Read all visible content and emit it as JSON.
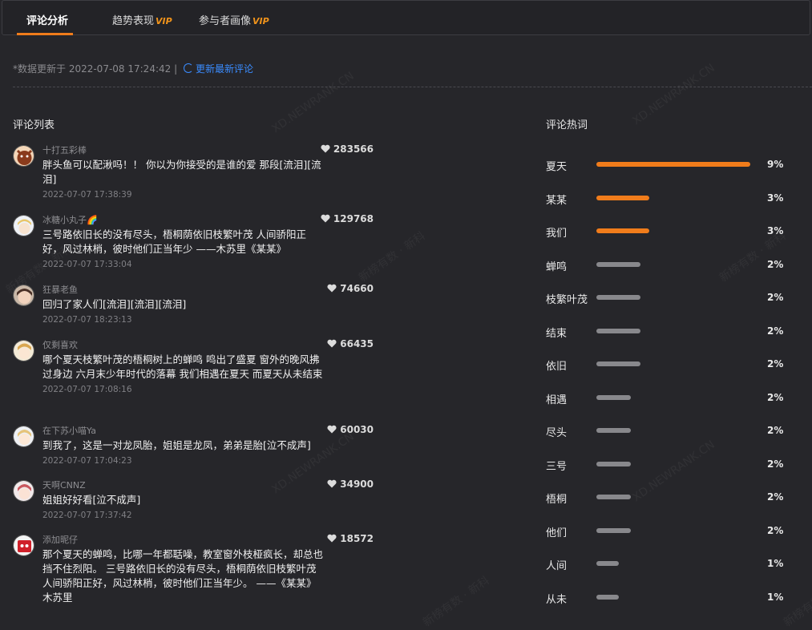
{
  "tabs": [
    {
      "label": "评论分析",
      "vip": ""
    },
    {
      "label": "趋势表现",
      "vip": "VIP"
    },
    {
      "label": "参与者画像",
      "vip": "VIP"
    }
  ],
  "update": {
    "text": "*数据更新于 2022-07-08 17:24:42 |",
    "refresh_label": "更新最新评论"
  },
  "comments_section": {
    "title": "评论列表"
  },
  "comments": [
    {
      "user": "十打五彩棒",
      "text": "胖头鱼可以配湫吗！！ 你以为你接受的是谁的爱 那段[流泪][流泪]",
      "time": "2022-07-07 17:38:39",
      "likes": "283566"
    },
    {
      "user": "冰糖小丸子🌈",
      "text": "三号路依旧长的没有尽头，梧桐荫依旧枝繁叶茂 人间骄阳正好，风过林梢，彼时他们正当年少 ——木苏里《某某》",
      "time": "2022-07-07 17:33:04",
      "likes": "129768"
    },
    {
      "user": "狂暴老鱼",
      "text": "回归了家人们[流泪][流泪][流泪]",
      "time": "2022-07-07 18:23:13",
      "likes": "74660"
    },
    {
      "user": "仅剩喜欢",
      "text": "哪个夏天枝繁叶茂的梧桐树上的蝉鸣 鸣出了盛夏 窗外的晚风拂过身边 六月末少年时代的落幕 我们相遇在夏天 而夏天从未结束",
      "time": "2022-07-07 17:08:16",
      "likes": "66435"
    },
    {
      "user": "在下苏小喵Ya",
      "text": "到我了，这是一对龙凤胎，姐姐是龙凤，弟弟是胎[泣不成声]",
      "time": "2022-07-07 17:04:23",
      "likes": "60030"
    },
    {
      "user": "天啊CNNZ",
      "text": "姐姐好好看[泣不成声]",
      "time": "2022-07-07 17:37:42",
      "likes": "34900"
    },
    {
      "user": "添加昵仔",
      "text": "那个夏天的蝉鸣，比哪一年都聒噪，教室窗外枝桠疯长，却总也挡不住烈阳。 三号路依旧长的没有尽头，梧桐荫依旧枝繁叶茂人间骄阳正好，风过林梢，彼时他们正当年少。 ——《某某》木苏里",
      "time": "",
      "likes": "18572"
    }
  ],
  "hot_section": {
    "title": "评论热词"
  },
  "hot_words": [
    {
      "word": "夏天",
      "pct": "9%",
      "level": 0.9,
      "highlight": true
    },
    {
      "word": "某某",
      "pct": "3%",
      "level": 0.31,
      "highlight": true
    },
    {
      "word": "我们",
      "pct": "3%",
      "level": 0.31,
      "highlight": true
    },
    {
      "word": "蝉鸣",
      "pct": "2%",
      "level": 0.26,
      "highlight": false
    },
    {
      "word": "枝繁叶茂",
      "pct": "2%",
      "level": 0.26,
      "highlight": false
    },
    {
      "word": "结束",
      "pct": "2%",
      "level": 0.26,
      "highlight": false
    },
    {
      "word": "依旧",
      "pct": "2%",
      "level": 0.26,
      "highlight": false
    },
    {
      "word": "相遇",
      "pct": "2%",
      "level": 0.2,
      "highlight": false
    },
    {
      "word": "尽头",
      "pct": "2%",
      "level": 0.2,
      "highlight": false
    },
    {
      "word": "三号",
      "pct": "2%",
      "level": 0.2,
      "highlight": false
    },
    {
      "word": "梧桐",
      "pct": "2%",
      "level": 0.2,
      "highlight": false
    },
    {
      "word": "他们",
      "pct": "2%",
      "level": 0.2,
      "highlight": false
    },
    {
      "word": "人间",
      "pct": "1%",
      "level": 0.13,
      "highlight": false
    },
    {
      "word": "从未",
      "pct": "1%",
      "level": 0.13,
      "highlight": false
    }
  ],
  "watermark": {
    "text1": "XD.NEWRANK.CN",
    "text2": "新榜有数 · 新科"
  },
  "colors": {
    "accent": "#f07c1b",
    "link": "#3a8cff",
    "bar_gray": "#88888c",
    "background": "#26262a"
  }
}
